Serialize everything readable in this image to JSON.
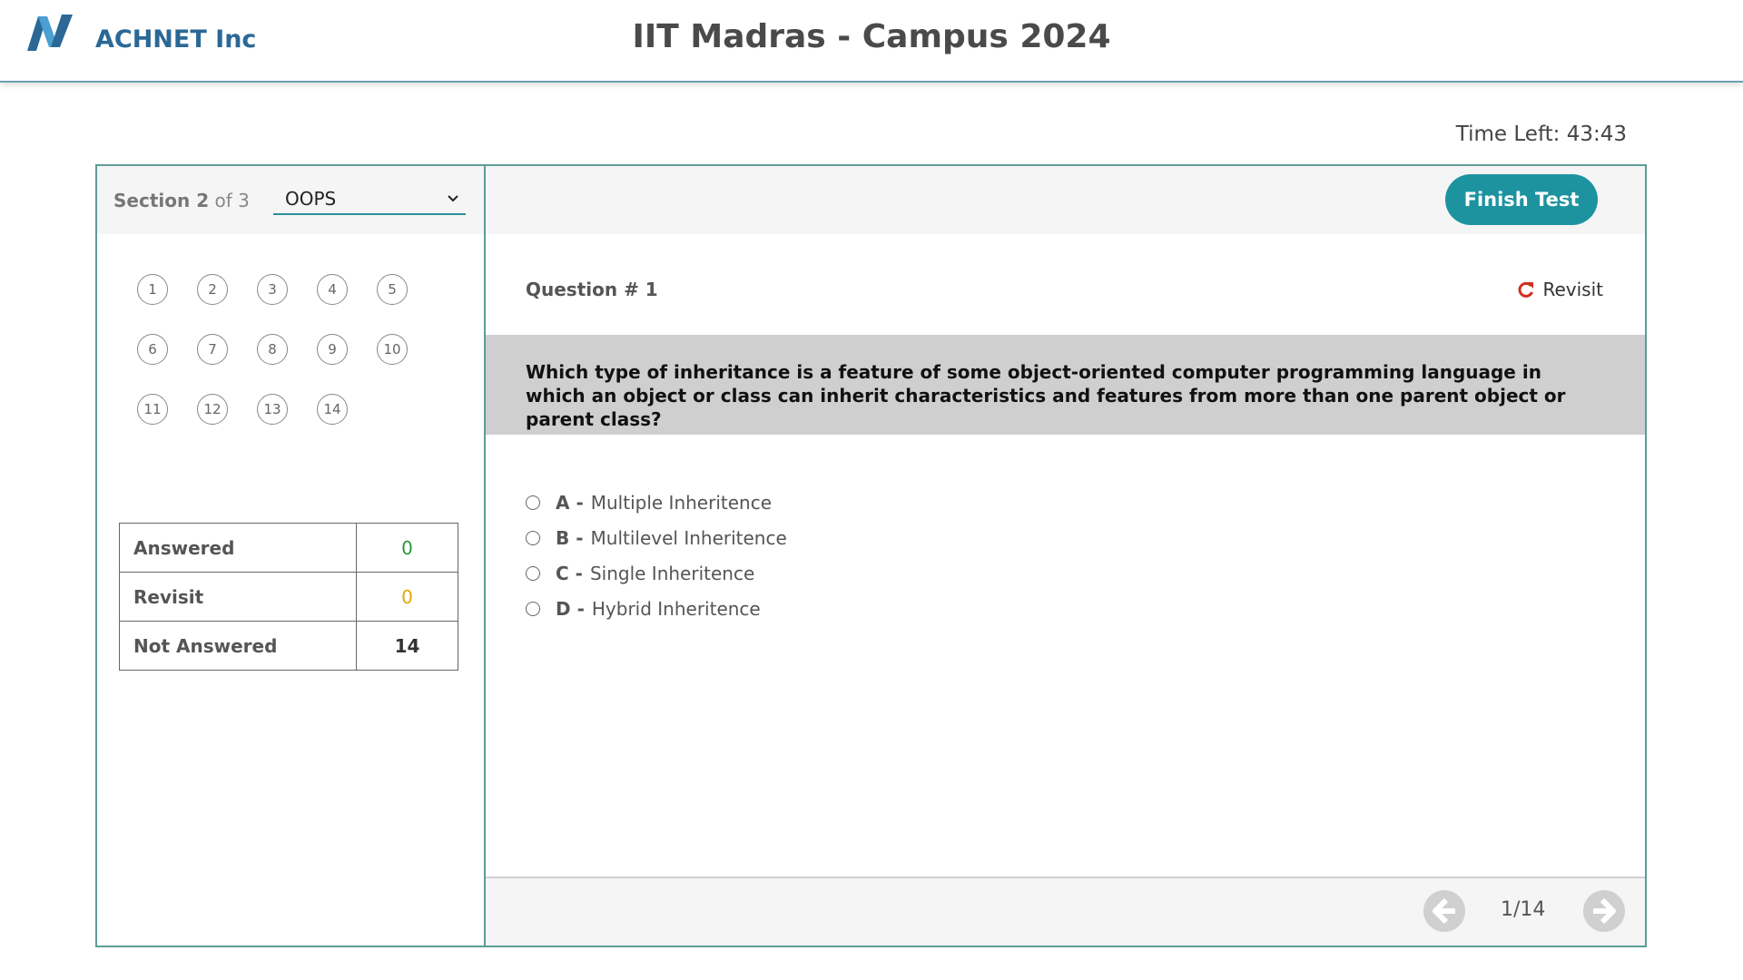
{
  "header": {
    "brand": "ACHNET Inc",
    "title": "IIT Madras - Campus 2024"
  },
  "timer": {
    "label": "Time Left: 43:43"
  },
  "sidebar": {
    "section_word": "Section",
    "section_current": "2",
    "section_of": "of 3",
    "section_selected": "OOPS",
    "questions": [
      "1",
      "2",
      "3",
      "4",
      "5",
      "6",
      "7",
      "8",
      "9",
      "10",
      "11",
      "12",
      "13",
      "14"
    ],
    "stats": [
      {
        "label": "Answered",
        "value": "0",
        "color": "#2a9a3a"
      },
      {
        "label": "Revisit",
        "value": "0",
        "color": "#e0a800"
      },
      {
        "label": "Not Answered",
        "value": "14",
        "color": "#333333"
      }
    ]
  },
  "main": {
    "finish_label": "Finish Test",
    "question_label": "Question # 1",
    "revisit_label": "Revisit",
    "question_text": "Which type of inheritance is a feature of some object-oriented computer programming language in which an object or class can inherit characteristics and features from more than one parent object or parent class?",
    "options": [
      {
        "letter": "A -",
        "text": "Multiple Inheritence"
      },
      {
        "letter": "B -",
        "text": "Multilevel Inheritence"
      },
      {
        "letter": "C -",
        "text": "Single Inheritence"
      },
      {
        "letter": "D -",
        "text": "Hybrid Inheritence"
      }
    ],
    "page_indicator": "1/14"
  },
  "colors": {
    "accent": "#1e93a0",
    "brand": "#2b6896",
    "revisit_icon": "#d0301e"
  },
  "icons": [
    "logo-icon",
    "chevron-down-icon",
    "revisit-icon",
    "arrow-left-icon",
    "arrow-right-icon"
  ]
}
